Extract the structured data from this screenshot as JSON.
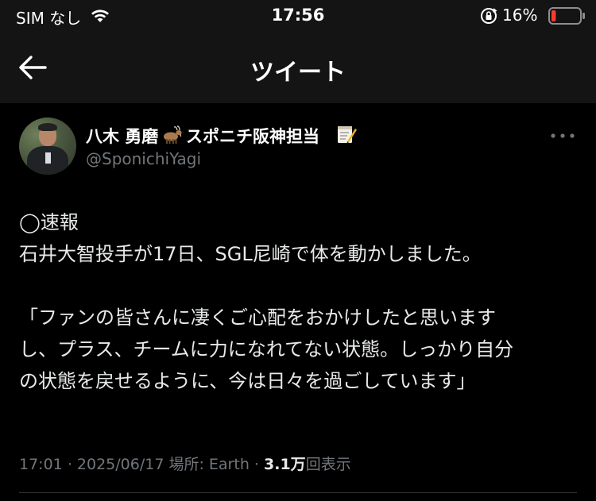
{
  "status_bar": {
    "carrier": "SIM なし",
    "time": "17:56",
    "battery_percent": "16%",
    "battery_level": 0.16,
    "battery_color": "#ff3b30"
  },
  "nav": {
    "back_icon": "arrow-left-icon",
    "title": "ツイート"
  },
  "tweet": {
    "author": {
      "name_part1": "八木 勇磨",
      "name_emoji": "goat-icon",
      "name_part2": "スポニチ阪神担当",
      "name_emoji2": "memo-icon",
      "handle": "@SponichiYagi"
    },
    "more_icon": "more-horizontal-icon",
    "body_lines": [
      "◯速報",
      "石井大智投手が17日、SGL尼崎で体を動かしました。",
      "",
      "「ファンの皆さんに凄くご心配をおかけしたと思います",
      "し、プラス、チームに力になれてない状態。しっかり自分",
      "の状態を戻せるように、今は日々を過ごしています」"
    ],
    "meta": {
      "time": "17:01",
      "separator": "·",
      "date": "2025/06/17",
      "location": "場所: Earth",
      "views_count": "3.1万",
      "views_label": "回表示"
    }
  },
  "colors": {
    "background": "#000000",
    "header_bg": "#141414",
    "text_primary": "#e7e9ea",
    "text_secondary": "#71767b"
  }
}
